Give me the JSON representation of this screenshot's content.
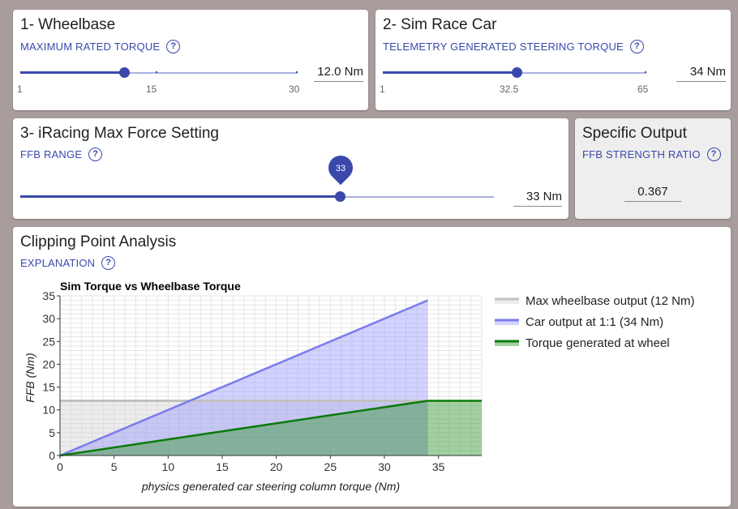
{
  "wheelbase": {
    "title": "1- Wheelbase",
    "subtitle": "MAXIMUM RATED TORQUE",
    "min_label": "1",
    "mid_label": "15",
    "max_label": "30",
    "value_text": "12.0 Nm",
    "slider_value": 12,
    "slider_min": 1,
    "slider_max": 30
  },
  "simcar": {
    "title": "2- Sim Race Car",
    "subtitle": "TELEMETRY GENERATED STEERING TORQUE",
    "min_label": "1",
    "mid_label": "32.5",
    "max_label": "65",
    "value_text": "34 Nm",
    "slider_value": 34,
    "slider_min": 1,
    "slider_max": 65
  },
  "iracing": {
    "title": "3- iRacing Max Force Setting",
    "subtitle": "FFB RANGE",
    "pin_label": "33",
    "value_text": "33 Nm",
    "slider_value": 33
  },
  "specific": {
    "title": "Specific Output",
    "subtitle": "FFB STRENGTH RATIO",
    "value_text": "0.367"
  },
  "clipping": {
    "title": "Clipping Point Analysis",
    "subtitle": "EXPLANATION"
  },
  "help_glyph": "?",
  "help_icon": "help-circle-icon",
  "colors": {
    "accent": "#3949ab",
    "max_line": "#c0c0c0",
    "car_line": "#7b7bef",
    "torque_line": "#0a7a0a"
  },
  "chart_data": {
    "type": "area",
    "title": "Sim Torque vs Wheelbase Torque",
    "xlabel": "physics generated car steering column torque (Nm)",
    "ylabel": "FFB (Nm)",
    "xlim": [
      0,
      39
    ],
    "ylim": [
      0,
      35
    ],
    "xticks": [
      0,
      5,
      10,
      15,
      20,
      25,
      30,
      35
    ],
    "yticks": [
      0,
      5,
      10,
      15,
      20,
      25,
      30,
      35
    ],
    "grid": true,
    "legend_position": "right",
    "series": [
      {
        "name": "Max wheelbase output (12 Nm)",
        "color": "#c0c0c0",
        "fill": "rgba(200,200,200,0.35)",
        "points": [
          [
            0,
            12
          ],
          [
            34,
            12
          ]
        ]
      },
      {
        "name": "Car output at 1:1 (34 Nm)",
        "color": "#7b7bef",
        "fill": "rgba(140,140,255,0.38)",
        "points": [
          [
            0,
            0
          ],
          [
            34,
            34
          ]
        ]
      },
      {
        "name": "Torque generated at wheel",
        "color": "#0a7a0a",
        "fill": "rgba(50,150,50,0.45)",
        "points": [
          [
            0,
            0
          ],
          [
            34,
            12
          ],
          [
            39,
            12
          ]
        ]
      }
    ]
  }
}
